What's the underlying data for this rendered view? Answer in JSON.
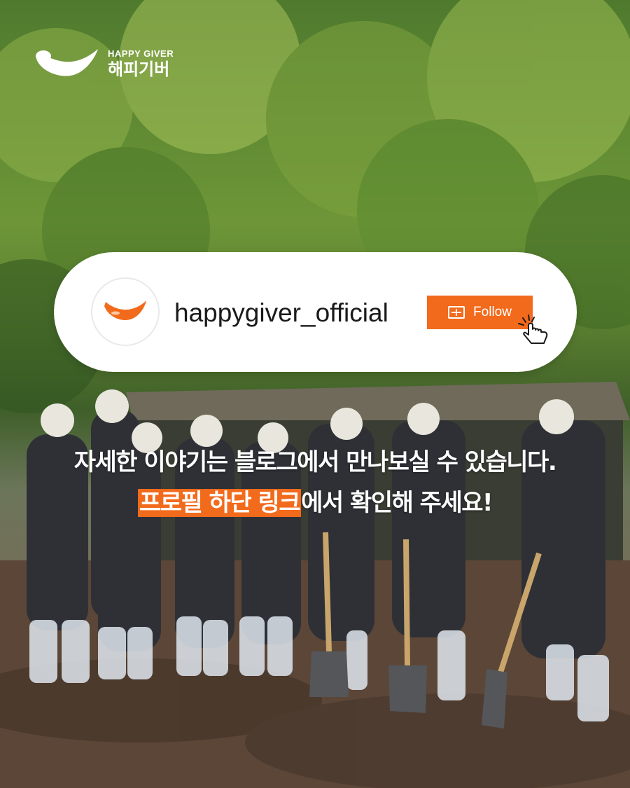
{
  "brand": {
    "name_en": "HAPPY GIVER",
    "name_ko": "해피기버",
    "accent_color": "#f26a1b"
  },
  "profile_card": {
    "handle": "happygiver_official",
    "follow_label": "Follow",
    "follow_icon": "plus-square-icon",
    "cursor_icon": "pointer-hand-click-icon"
  },
  "caption": {
    "line1": "자세한 이야기는 블로그에서 만나보실 수 있습니다.",
    "line2_highlight": "프로필 하단 링크",
    "line2_rest": "에서 확인해 주세요!"
  }
}
